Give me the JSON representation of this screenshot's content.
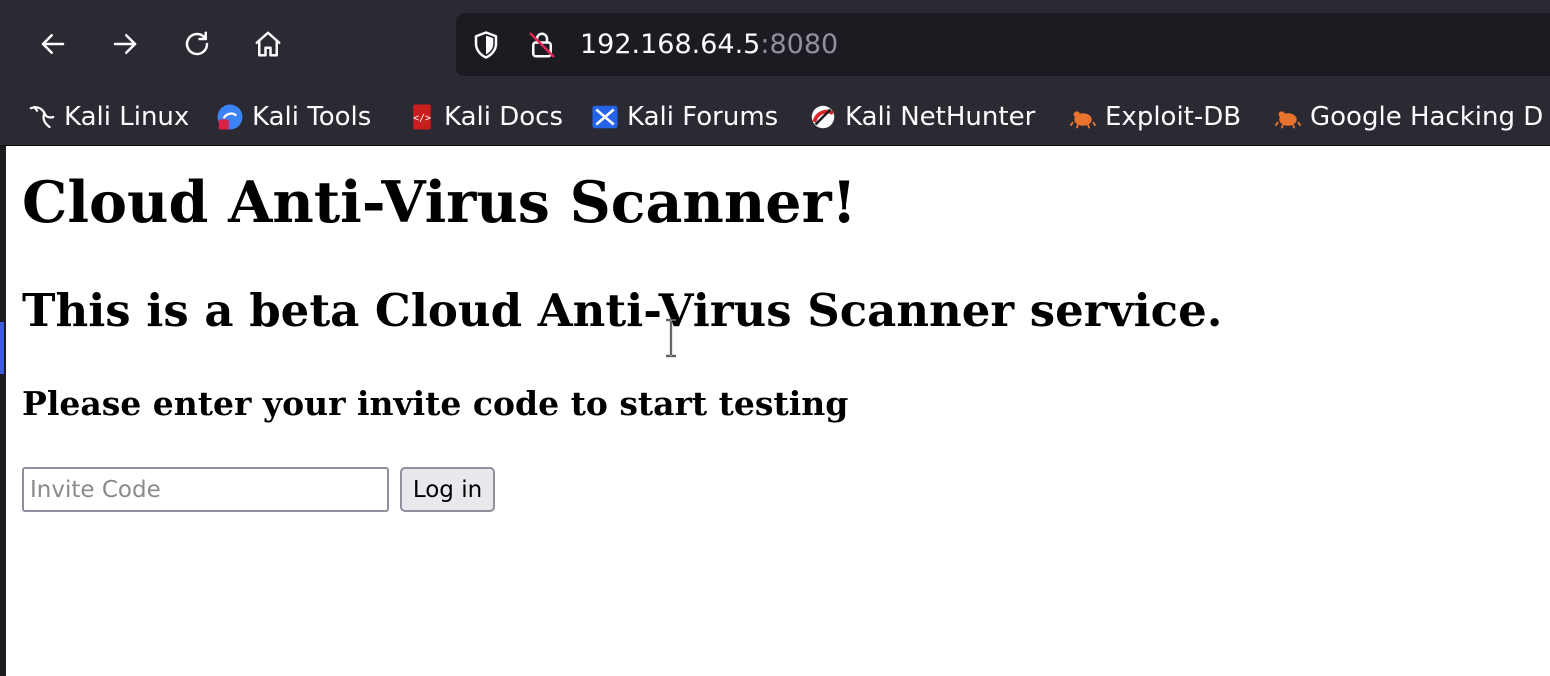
{
  "toolbar": {
    "nav_icons": [
      "back-arrow-icon",
      "forward-arrow-icon",
      "reload-icon",
      "home-icon"
    ],
    "url_icons": [
      "shield-icon",
      "insecure-lock-icon"
    ],
    "url_host": "192.168.64.5",
    "url_port": ":8080"
  },
  "bookmarks": [
    {
      "label": "Kali Linux",
      "icon": "kali-dragon-icon"
    },
    {
      "label": "Kali Tools",
      "icon": "kali-tools-icon"
    },
    {
      "label": "Kali Docs",
      "icon": "kali-docs-icon"
    },
    {
      "label": "Kali Forums",
      "icon": "kali-forums-icon"
    },
    {
      "label": "Kali NetHunter",
      "icon": "kali-nethunter-icon"
    },
    {
      "label": "Exploit-DB",
      "icon": "exploit-db-icon"
    },
    {
      "label": "Google Hacking D",
      "icon": "ghdb-icon"
    }
  ],
  "page": {
    "title": "Cloud Anti-Virus Scanner!",
    "subtitle": "This is a beta Cloud Anti-Virus Scanner service.",
    "prompt": "Please enter your invite code to start testing",
    "invite_input": {
      "placeholder": "Invite Code",
      "value": ""
    },
    "login_button": "Log in"
  },
  "colors": {
    "toolbar_bg": "#2b2a33",
    "urlbar_bg": "#1c1b22",
    "text_light": "#fbfbfe",
    "port_text": "#8f8f9d",
    "page_bg": "#ffffff"
  }
}
